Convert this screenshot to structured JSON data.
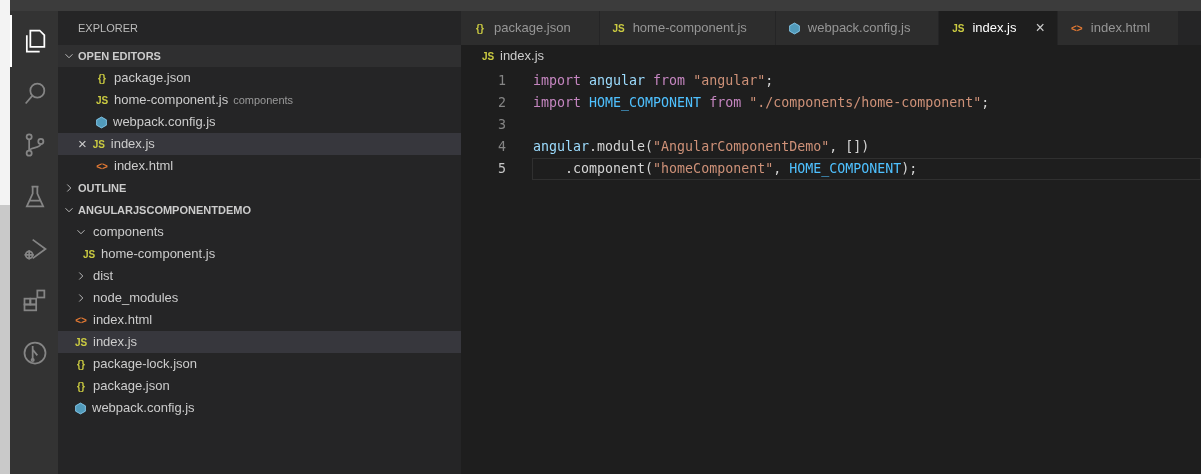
{
  "activity_bar": [
    {
      "selected": true
    },
    {
      "selected": false
    },
    {
      "selected": false
    },
    {
      "selected": false
    },
    {
      "selected": false
    },
    {
      "selected": false
    },
    {
      "selected": false
    }
  ],
  "sidebar": {
    "title": "EXPLORER",
    "open_editors": {
      "label": "OPEN EDITORS",
      "expanded": true,
      "items": [
        {
          "name": "package.json",
          "kind": "json",
          "badge": "{}",
          "selected": false
        },
        {
          "name": "home-component.js",
          "detail": "components",
          "kind": "js",
          "badge": "JS",
          "selected": false
        },
        {
          "name": "webpack.config.js",
          "kind": "webpack",
          "selected": false
        },
        {
          "name": "index.js",
          "kind": "js",
          "badge": "JS",
          "selected": true,
          "close": "×"
        },
        {
          "name": "index.html",
          "kind": "html",
          "badge": "<>",
          "selected": false
        }
      ]
    },
    "outline": {
      "label": "OUTLINE",
      "expanded": false
    },
    "project": {
      "label": "ANGULARJSCOMPONENTDEMO",
      "expanded": true,
      "children": [
        {
          "name": "components",
          "kind": "folder",
          "expanded": true,
          "selected": false,
          "children": [
            {
              "name": "home-component.js",
              "kind": "js",
              "badge": "JS",
              "selected": false
            }
          ]
        },
        {
          "name": "dist",
          "kind": "folder",
          "expanded": false,
          "selected": false
        },
        {
          "name": "node_modules",
          "kind": "folder",
          "expanded": false,
          "selected": false
        },
        {
          "name": "index.html",
          "kind": "html",
          "badge": "<>",
          "selected": false
        },
        {
          "name": "index.js",
          "kind": "js",
          "badge": "JS",
          "selected": true
        },
        {
          "name": "package-lock.json",
          "kind": "json",
          "badge": "{}",
          "selected": false
        },
        {
          "name": "package.json",
          "kind": "json",
          "badge": "{}",
          "selected": false
        },
        {
          "name": "webpack.config.js",
          "kind": "webpack",
          "selected": false
        }
      ]
    }
  },
  "tabs": [
    {
      "label": "package.json",
      "kind": "json",
      "badge": "{}",
      "selected": false
    },
    {
      "label": "home-component.js",
      "kind": "js",
      "badge": "JS",
      "selected": false
    },
    {
      "label": "webpack.config.js",
      "kind": "webpack",
      "selected": false
    },
    {
      "label": "index.js",
      "kind": "js",
      "badge": "JS",
      "selected": true,
      "close": "×"
    },
    {
      "label": "index.html",
      "kind": "html",
      "badge": "<>",
      "selected": false
    }
  ],
  "breadcrumb": {
    "label": "index.js",
    "kind": "js",
    "badge": "JS"
  },
  "editor": {
    "lines": [
      {
        "number": "1",
        "current": false,
        "tokens": [
          {
            "text": "import ",
            "kind": "keyword"
          },
          {
            "text": "angular ",
            "kind": "variable"
          },
          {
            "text": "from ",
            "kind": "keyword"
          },
          {
            "text": "\"angular\"",
            "kind": "string"
          },
          {
            "text": ";",
            "kind": "plain"
          }
        ]
      },
      {
        "number": "2",
        "current": false,
        "tokens": [
          {
            "text": "import ",
            "kind": "keyword"
          },
          {
            "text": "HOME_COMPONENT ",
            "kind": "constant"
          },
          {
            "text": "from ",
            "kind": "keyword"
          },
          {
            "text": "\"./components/home-component\"",
            "kind": "string"
          },
          {
            "text": ";",
            "kind": "plain"
          }
        ]
      },
      {
        "number": "3",
        "current": false
      },
      {
        "number": "4",
        "current": false,
        "tokens": [
          {
            "text": "angular",
            "kind": "variable"
          },
          {
            "text": ".module(",
            "kind": "plain"
          },
          {
            "text": "\"AngularComponentDemo\"",
            "kind": "string"
          },
          {
            "text": ", [])",
            "kind": "plain"
          }
        ]
      },
      {
        "number": "5",
        "current": true,
        "tokens": [
          {
            "text": "    .component(",
            "kind": "plain"
          },
          {
            "text": "\"homeComponent\"",
            "kind": "string"
          },
          {
            "text": ", ",
            "kind": "plain"
          },
          {
            "text": "HOME_COMPONENT",
            "kind": "constant"
          },
          {
            "text": ");",
            "kind": "plain"
          }
        ]
      }
    ]
  }
}
